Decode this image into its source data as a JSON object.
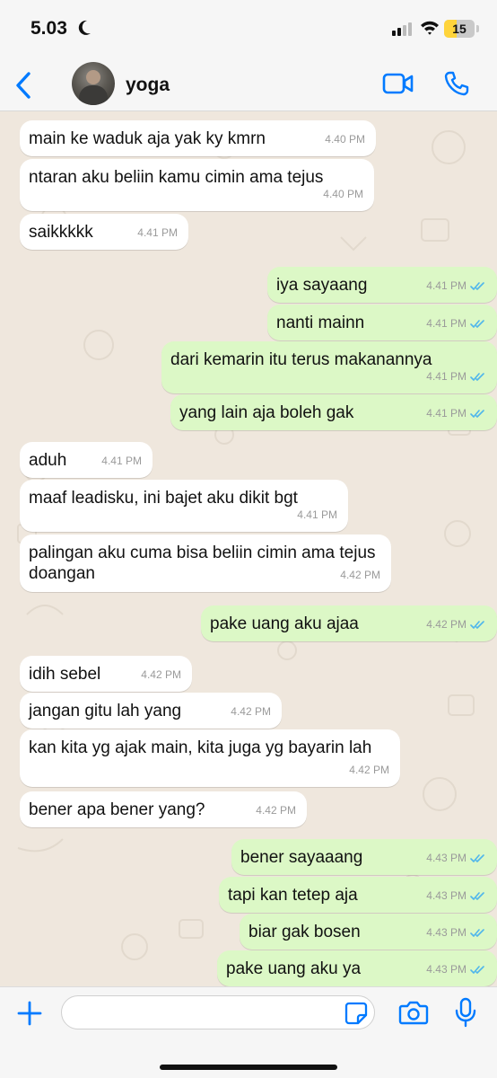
{
  "status_bar": {
    "time": "5.03",
    "battery_level": "15"
  },
  "header": {
    "contact_name": "yoga"
  },
  "messages": [
    {
      "dir": "in",
      "text": "main ke waduk aja yak ky kmrn",
      "time": "4.40 PM"
    },
    {
      "dir": "in",
      "text": "ntaran aku beliin kamu cimin ama tejus",
      "time": "4.40 PM"
    },
    {
      "dir": "in",
      "text": "saikkkkk",
      "time": "4.41 PM"
    },
    {
      "dir": "out",
      "text": "iya sayaang",
      "time": "4.41 PM"
    },
    {
      "dir": "out",
      "text": "nanti mainn",
      "time": "4.41 PM"
    },
    {
      "dir": "out",
      "text": "dari kemarin itu terus makanannya",
      "time": "4.41 PM"
    },
    {
      "dir": "out",
      "text": "yang lain aja boleh gak",
      "time": "4.41 PM"
    },
    {
      "dir": "in",
      "text": "aduh",
      "time": "4.41 PM"
    },
    {
      "dir": "in",
      "text": "maaf leadisku, ini bajet aku dikit bgt",
      "time": "4.41 PM"
    },
    {
      "dir": "in",
      "text": "palingan aku cuma bisa beliin cimin ama tejus doangan",
      "time": "4.42 PM"
    },
    {
      "dir": "out",
      "text": "pake uang aku ajaa",
      "time": "4.42 PM"
    },
    {
      "dir": "in",
      "text": "idih sebel",
      "time": "4.42 PM"
    },
    {
      "dir": "in",
      "text": "jangan gitu lah yang",
      "time": "4.42 PM"
    },
    {
      "dir": "in",
      "text": "kan kita yg ajak main, kita juga yg bayarin lah",
      "time": "4.42 PM"
    },
    {
      "dir": "in",
      "text": "bener apa bener yang?",
      "time": "4.42 PM"
    },
    {
      "dir": "out",
      "text": "bener sayaaang",
      "time": "4.43 PM"
    },
    {
      "dir": "out",
      "text": "tapi kan tetep aja",
      "time": "4.43 PM"
    },
    {
      "dir": "out",
      "text": "biar gak bosen",
      "time": "4.43 PM"
    },
    {
      "dir": "out",
      "text": "pake uang aku ya",
      "time": "4.43 PM"
    }
  ],
  "composer": {
    "value": "",
    "placeholder": ""
  },
  "colors": {
    "accent": "#007aff",
    "outgoing_bubble": "#dcf8c6",
    "incoming_bubble": "#ffffff",
    "read_ticks": "#4fb6ec",
    "wallpaper": "#efe7dd"
  }
}
